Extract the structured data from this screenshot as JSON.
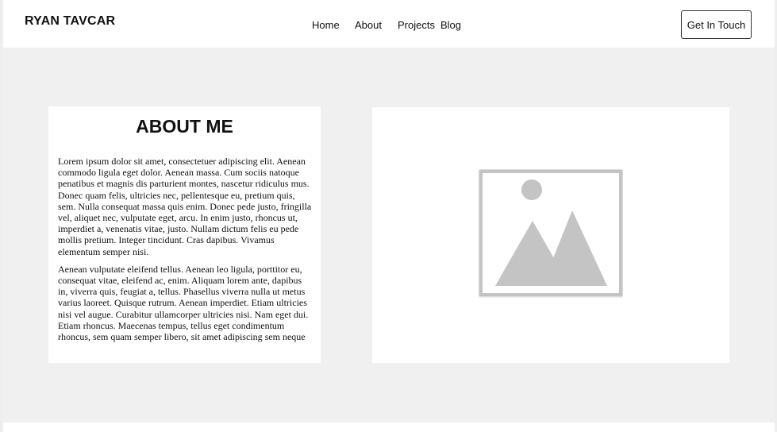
{
  "header": {
    "brand": "RYAN TAVCAR",
    "nav": {
      "home": "Home",
      "about": "About",
      "projects": "Projects",
      "blog": "Blog"
    },
    "cta_label": "Get In Touch"
  },
  "about": {
    "title": "ABOUT ME",
    "paragraphs": [
      "Lorem ipsum dolor sit amet, consectetuer adipiscing elit. Aenean commodo ligula eget dolor. Aenean massa. Cum sociis natoque penatibus et magnis dis parturient montes, nascetur ridiculus mus. Donec quam felis, ultricies nec, pellentesque eu, pretium quis, sem. Nulla consequat massa quis enim. Donec pede justo, fringilla vel, aliquet nec, vulputate eget, arcu. In enim justo, rhoncus ut, imperdiet a, venenatis vitae, justo. Nullam dictum felis eu pede mollis pretium. Integer tincidunt. Cras dapibus. Vivamus elementum semper nisi.",
      "Aenean vulputate eleifend tellus. Aenean leo ligula, porttitor eu, consequat vitae, eleifend ac, enim. Aliquam lorem ante, dapibus in, viverra quis, feugiat a, tellus. Phasellus viverra nulla ut metus varius laoreet. Quisque rutrum. Aenean imperdiet. Etiam ultricies nisi vel augue. Curabitur ullamcorper ultricies nisi. Nam eget dui. Etiam rhoncus. Maecenas tempus, tellus eget condimentum rhoncus, sem quam semper libero, sit amet adipiscing sem neque"
    ]
  },
  "image": {
    "icon": "image-placeholder-icon"
  },
  "colors": {
    "background": "#f0f0f0",
    "card": "#ffffff",
    "placeholder": "#c4c4c4"
  }
}
